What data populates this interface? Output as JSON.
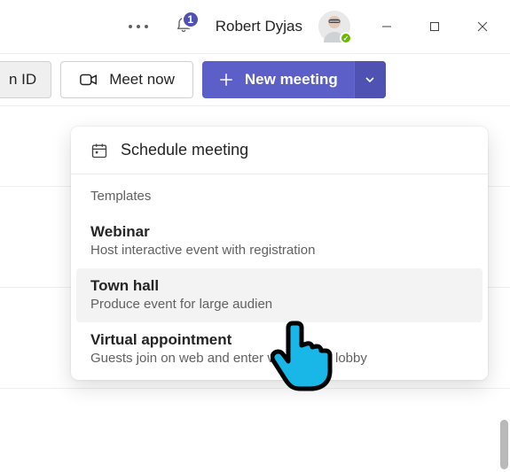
{
  "header": {
    "notification_count": "1",
    "user_name": "Robert Dyjas"
  },
  "toolbar": {
    "join_id_label": "n ID",
    "meet_now_label": "Meet now",
    "new_meeting_label": "New meeting"
  },
  "menu": {
    "schedule_label": "Schedule meeting",
    "templates_label": "Templates",
    "items": [
      {
        "title": "Webinar",
        "subtitle": "Host interactive event with registration"
      },
      {
        "title": "Town hall",
        "subtitle": "Produce event for large audien"
      },
      {
        "title": "Virtual appointment",
        "subtitle": "Guests join on web and enter via tailored lobby"
      }
    ]
  }
}
